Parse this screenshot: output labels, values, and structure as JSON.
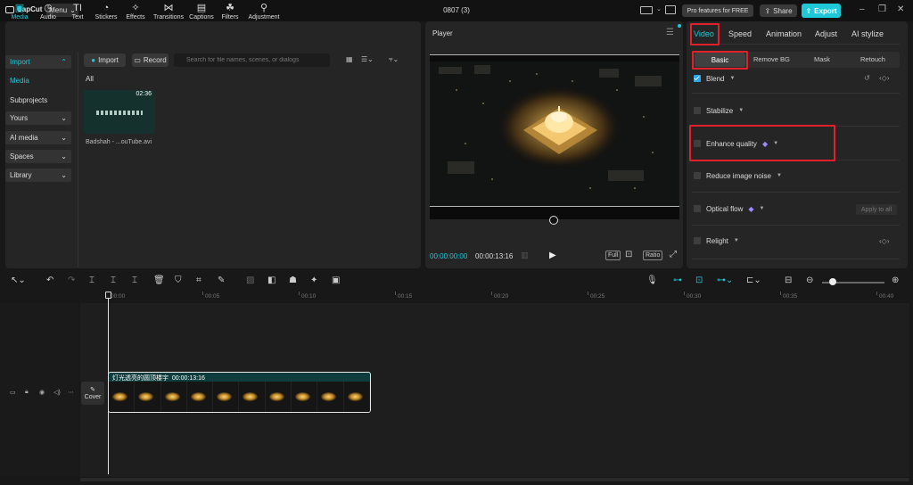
{
  "app": {
    "name": "CapCut",
    "menu_label": "Menu",
    "project_title": "0807 (3)"
  },
  "topbar": {
    "pro_label": "Pro features for FREE",
    "share_label": "Share",
    "export_label": "Export",
    "accent_color": "#1ec8d8"
  },
  "media_toolbar": [
    {
      "label": "Media",
      "icon": "media-icon",
      "active": true
    },
    {
      "label": "Audio",
      "icon": "audio-icon"
    },
    {
      "label": "Text",
      "icon": "text-icon"
    },
    {
      "label": "Stickers",
      "icon": "stickers-icon"
    },
    {
      "label": "Effects",
      "icon": "effects-icon"
    },
    {
      "label": "Transitions",
      "icon": "transitions-icon"
    },
    {
      "label": "Captions",
      "icon": "captions-icon"
    },
    {
      "label": "Filters",
      "icon": "filters-icon"
    },
    {
      "label": "Adjustment",
      "icon": "adjustment-icon"
    }
  ],
  "left_nav": {
    "import": "Import",
    "media": "Media",
    "subprojects": "Subprojects",
    "yours": "Yours",
    "ai_media": "AI media",
    "spaces": "Spaces",
    "library": "Library"
  },
  "media_panel": {
    "import_btn": "Import",
    "record_btn": "Record",
    "search_placeholder": "Search for file names, scenes, or dialogs",
    "all_label": "All",
    "item": {
      "duration": "02:36",
      "name": "Badshah - ...ouTube.avi"
    }
  },
  "player": {
    "title": "Player",
    "current_time": "00:00:00:00",
    "total_time": "00:00:13:16",
    "full_label": "Full",
    "ratio_label": "Ratio"
  },
  "right_panel": {
    "tabs": [
      "Video",
      "Speed",
      "Animation",
      "Adjust",
      "AI stylize"
    ],
    "subtabs": [
      "Basic",
      "Remove BG",
      "Mask",
      "Retouch"
    ],
    "options": {
      "blend": "Blend",
      "stabilize": "Stabilize",
      "enhance": "Enhance quality",
      "noise": "Reduce image noise",
      "optical": "Optical flow",
      "relight": "Relight"
    },
    "apply_all": "Apply to all"
  },
  "timeline": {
    "ticks": [
      "00:00",
      "00:05",
      "00:10",
      "00:15",
      "00:20",
      "00:25",
      "00:30",
      "00:35",
      "00:40"
    ],
    "cover_label": "Cover",
    "clip": {
      "title": "灯光透亮的圆顶楼宇",
      "duration": "00:00:13:16"
    }
  }
}
